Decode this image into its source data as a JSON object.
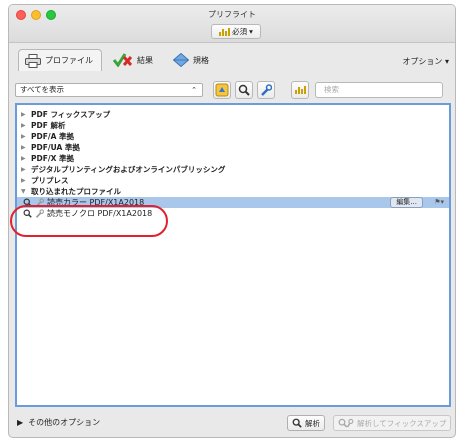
{
  "window": {
    "title": "プリフライト"
  },
  "header": {
    "required_label": "必須",
    "required_arrow": "▾"
  },
  "tabs": [
    {
      "label": "プロファイル"
    },
    {
      "label": "結果"
    },
    {
      "label": "規格"
    }
  ],
  "options_label": "オプション ▾",
  "filter": {
    "value": "すべてを表示",
    "arrow": "⌃"
  },
  "search": {
    "placeholder": "検索"
  },
  "categories": [
    "PDF フィックスアップ",
    "PDF 解析",
    "PDF/A 準拠",
    "PDF/UA 準拠",
    "PDF/X 準拠",
    "デジタルプリンティングおよびオンラインパブリッシング",
    "プリプレス",
    "取り込まれたプロファイル"
  ],
  "profiles": [
    {
      "label": "読売カラー PDF/X1A2018",
      "selected": true
    },
    {
      "label": "読売モノクロ PDF/X1A2018",
      "selected": false
    }
  ],
  "edit_label": "編集...",
  "footer": {
    "more_options": "その他のオプション",
    "analyze_label": "解析",
    "analyze_fix_label": "解析してフィックスアップ"
  },
  "colors": {
    "selection": "#a9c6eb",
    "highlight_oval": "#e0222e",
    "list_border": "#6a9bdb"
  }
}
